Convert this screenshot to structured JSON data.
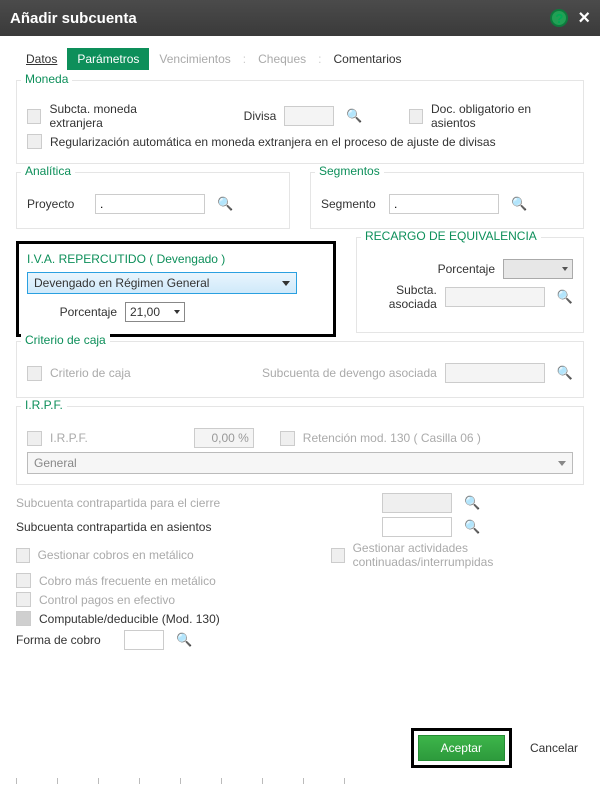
{
  "title": "Añadir subcuenta",
  "tabs": {
    "datos": "Datos",
    "parametros": "Parámetros",
    "vencimientos": "Vencimientos",
    "cheques": "Cheques",
    "comentarios": "Comentarios"
  },
  "moneda": {
    "legend": "Moneda",
    "extranjera": "Subcta. moneda extranjera",
    "divisa_label": "Divisa",
    "divisa_value": "",
    "doc_oblig": "Doc. obligatorio en asientos",
    "regularizacion": "Regularización automática en moneda extranjera en el proceso de ajuste de divisas"
  },
  "analitica": {
    "legend": "Analítica",
    "proyecto_label": "Proyecto",
    "proyecto_value": "."
  },
  "segmentos": {
    "legend": "Segmentos",
    "segmento_label": "Segmento",
    "segmento_value": "."
  },
  "iva": {
    "legend": "I.V.A. REPERCUTIDO ( Devengado )",
    "regimen": "Devengado en Régimen General",
    "pct_label": "Porcentaje",
    "pct_value": "21,00"
  },
  "recargo": {
    "legend": "RECARGO DE EQUIVALENCIA",
    "pct_label": "Porcentaje",
    "subcta_label": "Subcta. asociada",
    "subcta_value": ""
  },
  "criterio": {
    "legend": "Criterio de caja",
    "chk_label": "Criterio de caja",
    "sub_label": "Subcuenta de devengo asociada",
    "sub_value": ""
  },
  "irpf": {
    "legend": "I.R.P.F.",
    "chk_label": "I.R.P.F.",
    "pct_value": "0,00 %",
    "retencion": "Retención mod. 130 ( Casilla 06 )",
    "general": "General"
  },
  "extras": {
    "sub_cierre": "Subcuenta contrapartida para el cierre",
    "sub_asientos": "Subcuenta contrapartida en asientos",
    "gestionar_cobros": "Gestionar cobros en metálico",
    "gestionar_actividades": "Gestionar actividades continuadas/interrumpidas",
    "cobro_frecuente": "Cobro más frecuente en metálico",
    "control_pagos": "Control pagos en efectivo",
    "computable": "Computable/deducible (Mod. 130)",
    "forma_cobro": "Forma de cobro",
    "forma_cobro_value": ""
  },
  "footer": {
    "aceptar": "Aceptar",
    "cancelar": "Cancelar"
  }
}
